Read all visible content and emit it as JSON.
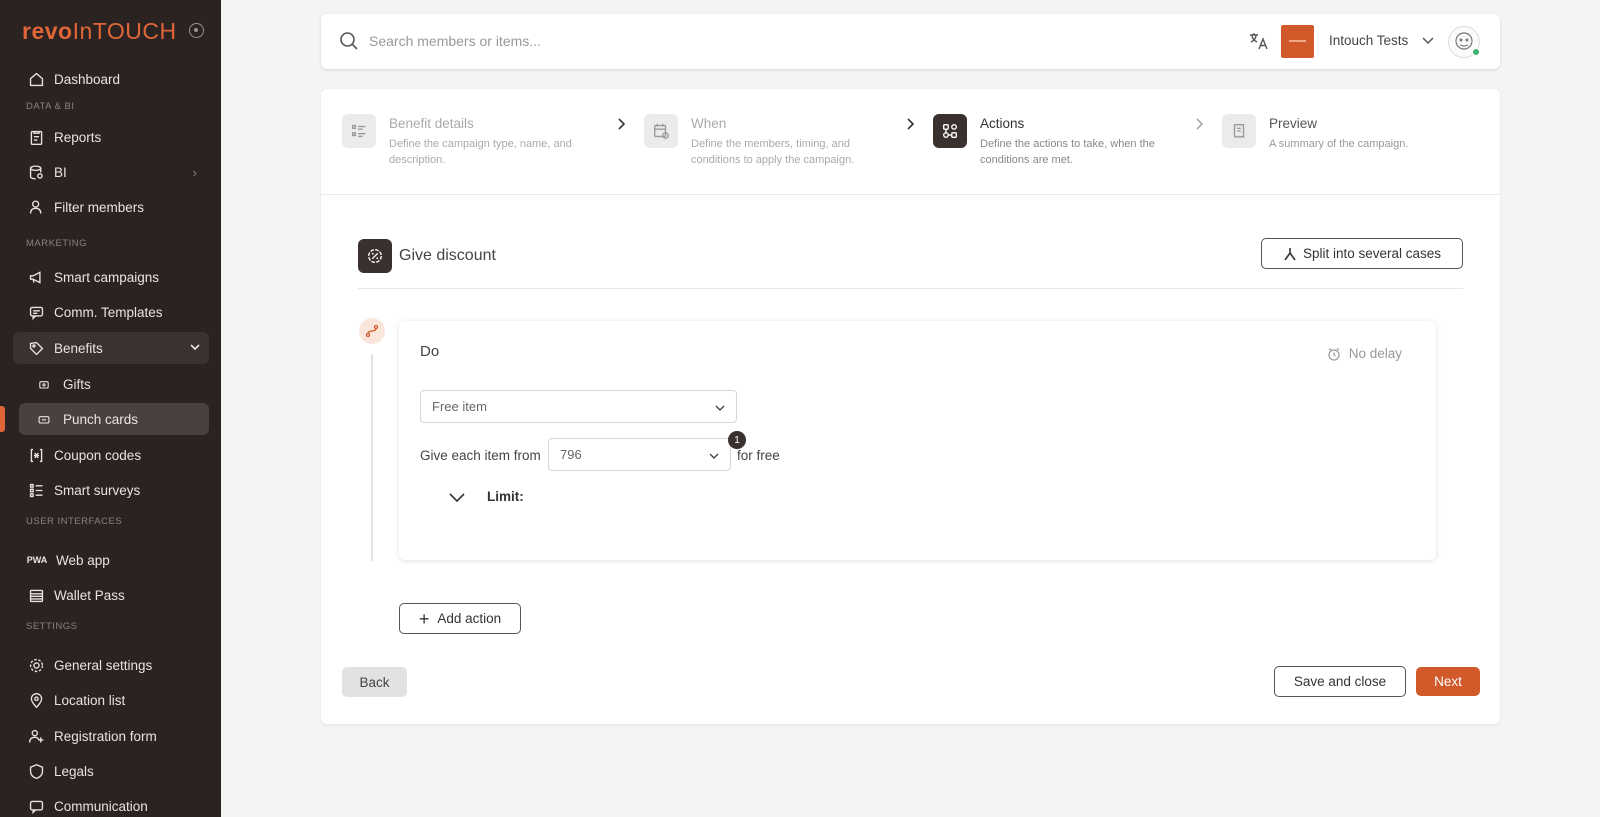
{
  "app": {
    "logo_part1": "revo",
    "logo_part2": "InTOUCH",
    "brand_color": "#e0663a"
  },
  "sidebar": {
    "items": [
      {
        "label": "Dashboard",
        "icon": "home-icon"
      },
      {
        "label": "Reports",
        "icon": "clipboard-icon"
      },
      {
        "label": "BI",
        "icon": "database-icon"
      },
      {
        "label": "Filter members",
        "icon": "user-search-icon"
      },
      {
        "label": "Smart campaigns",
        "icon": "megaphone-icon"
      },
      {
        "label": "Comm. Templates",
        "icon": "message-icon"
      },
      {
        "label": "Benefits",
        "icon": "tag-icon"
      },
      {
        "label": "Gifts",
        "icon": "gift-icon"
      },
      {
        "label": "Punch cards",
        "icon": "card-icon"
      },
      {
        "label": "Coupon codes",
        "icon": "code-icon"
      },
      {
        "label": "Smart surveys",
        "icon": "list-icon"
      },
      {
        "label": "Web app",
        "icon": "pwa-icon"
      },
      {
        "label": "Wallet Pass",
        "icon": "wallet-icon"
      },
      {
        "label": "General settings",
        "icon": "gear-icon"
      },
      {
        "label": "Location list",
        "icon": "pin-icon"
      },
      {
        "label": "Registration form",
        "icon": "user-plus-icon"
      },
      {
        "label": "Legals",
        "icon": "shield-icon"
      },
      {
        "label": "Communication",
        "icon": "chat-icon"
      }
    ],
    "sections": {
      "data_bi": "DATA & BI",
      "marketing": "MARKETING",
      "user_interfaces": "USER INTERFACES",
      "settings": "SETTINGS"
    },
    "pwa_glyph": "PWA"
  },
  "topbar": {
    "search_placeholder": "Search members or items...",
    "org_name": "Intouch Tests"
  },
  "steps": [
    {
      "title": "Benefit details",
      "desc": "Define the campaign type, name, and description."
    },
    {
      "title": "When",
      "desc": "Define the members, timing, and conditions to apply the campaign."
    },
    {
      "title": "Actions",
      "desc": "Define the actions to take, when the conditions are met."
    },
    {
      "title": "Preview",
      "desc": "A summary of the campaign."
    }
  ],
  "section": {
    "title": "Give discount",
    "split_label": "Split into several cases"
  },
  "do_card": {
    "title": "Do",
    "delay": "No delay",
    "action_type": "Free item",
    "give_label": "Give each item from",
    "item_value": "796",
    "badge_count": "1",
    "for_free": "for free",
    "limit_label": "Limit:"
  },
  "buttons": {
    "add_action": "Add action",
    "back": "Back",
    "save_close": "Save and close",
    "next": "Next"
  },
  "colors": {
    "accent": "#d2592a",
    "sidebar_bg": "#2a2321",
    "step_active": "#3a302d"
  }
}
